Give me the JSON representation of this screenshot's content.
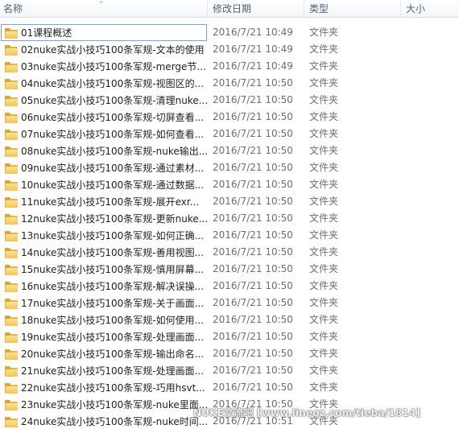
{
  "header": {
    "name_label": "名称",
    "date_label": "修改日期",
    "type_label": "类型",
    "size_label": "大小"
  },
  "rows": [
    {
      "name": "01课程概述",
      "date": "2016/7/21 10:49",
      "type": "文件夹"
    },
    {
      "name": "02nuke实战小技巧100条军规-文本的使用",
      "date": "2016/7/21 10:49",
      "type": "文件夹"
    },
    {
      "name": "03nuke实战小技巧100条军规-merge节...",
      "date": "2016/7/21 10:49",
      "type": "文件夹"
    },
    {
      "name": "04nuke实战小技巧100条军规-视图区的...",
      "date": "2016/7/21 10:50",
      "type": "文件夹"
    },
    {
      "name": "05nuke实战小技巧100条军规-清理nuke...",
      "date": "2016/7/21 10:50",
      "type": "文件夹"
    },
    {
      "name": "06nuke实战小技巧100条军规-切屏查看...",
      "date": "2016/7/21 10:50",
      "type": "文件夹"
    },
    {
      "name": "07nuke实战小技巧100条军规-如何查看...",
      "date": "2016/7/21 10:50",
      "type": "文件夹"
    },
    {
      "name": "08nuke实战小技巧100条军规-nuke输出...",
      "date": "2016/7/21 10:50",
      "type": "文件夹"
    },
    {
      "name": "09nuke实战小技巧100条军规-通过素材...",
      "date": "2016/7/21 10:50",
      "type": "文件夹"
    },
    {
      "name": "10nuke实战小技巧100条军规-通过数据...",
      "date": "2016/7/21 10:50",
      "type": "文件夹"
    },
    {
      "name": "11nuke实战小技巧100条军规-展开exr...",
      "date": "2016/7/21 10:50",
      "type": "文件夹"
    },
    {
      "name": "12nuke实战小技巧100条军规-更新nuke...",
      "date": "2016/7/21 10:50",
      "type": "文件夹"
    },
    {
      "name": "13nuke实战小技巧100条军规-如何正确...",
      "date": "2016/7/21 10:50",
      "type": "文件夹"
    },
    {
      "name": "14nuke实战小技巧100条军规-善用视图...",
      "date": "2016/7/21 10:50",
      "type": "文件夹"
    },
    {
      "name": "15nuke实战小技巧100条军规-慎用屏幕...",
      "date": "2016/7/21 10:50",
      "type": "文件夹"
    },
    {
      "name": "16nuke实战小技巧100条军规-解决误操...",
      "date": "2016/7/21 10:50",
      "type": "文件夹"
    },
    {
      "name": "17nuke实战小技巧100条军规-关于画面...",
      "date": "2016/7/21 10:50",
      "type": "文件夹"
    },
    {
      "name": "18nuke实战小技巧100条军规-如何使用...",
      "date": "2016/7/21 10:50",
      "type": "文件夹"
    },
    {
      "name": "19nuke实战小技巧100条军规-处理画面...",
      "date": "2016/7/21 10:50",
      "type": "文件夹"
    },
    {
      "name": "20nuke实战小技巧100条军规-输出命名...",
      "date": "2016/7/21 10:50",
      "type": "文件夹"
    },
    {
      "name": "21nuke实战小技巧100条军规-处理画面...",
      "date": "2016/7/21 10:50",
      "type": "文件夹"
    },
    {
      "name": "22nuke实战小技巧100条军规-巧用hsvt...",
      "date": "2016/7/21 10:50",
      "type": "文件夹"
    },
    {
      "name": "23nuke实战小技巧100条军规-nuke里面...",
      "date": "2016/7/21 10:50",
      "type": "文件夹"
    },
    {
      "name": "24nuke实战小技巧100条军规-nuke时间...",
      "date": "2016/7/21 10:51",
      "type": "文件夹"
    }
  ],
  "watermark": "NUKE交流吧 [www.lineqz.com/tieba/1814]",
  "colors": {
    "header_text": "#4c607a",
    "name_text": "#1e1e1e",
    "meta_text": "#6d6d6d",
    "folder": "#f2c458",
    "selection_border": "#7da2ce"
  }
}
